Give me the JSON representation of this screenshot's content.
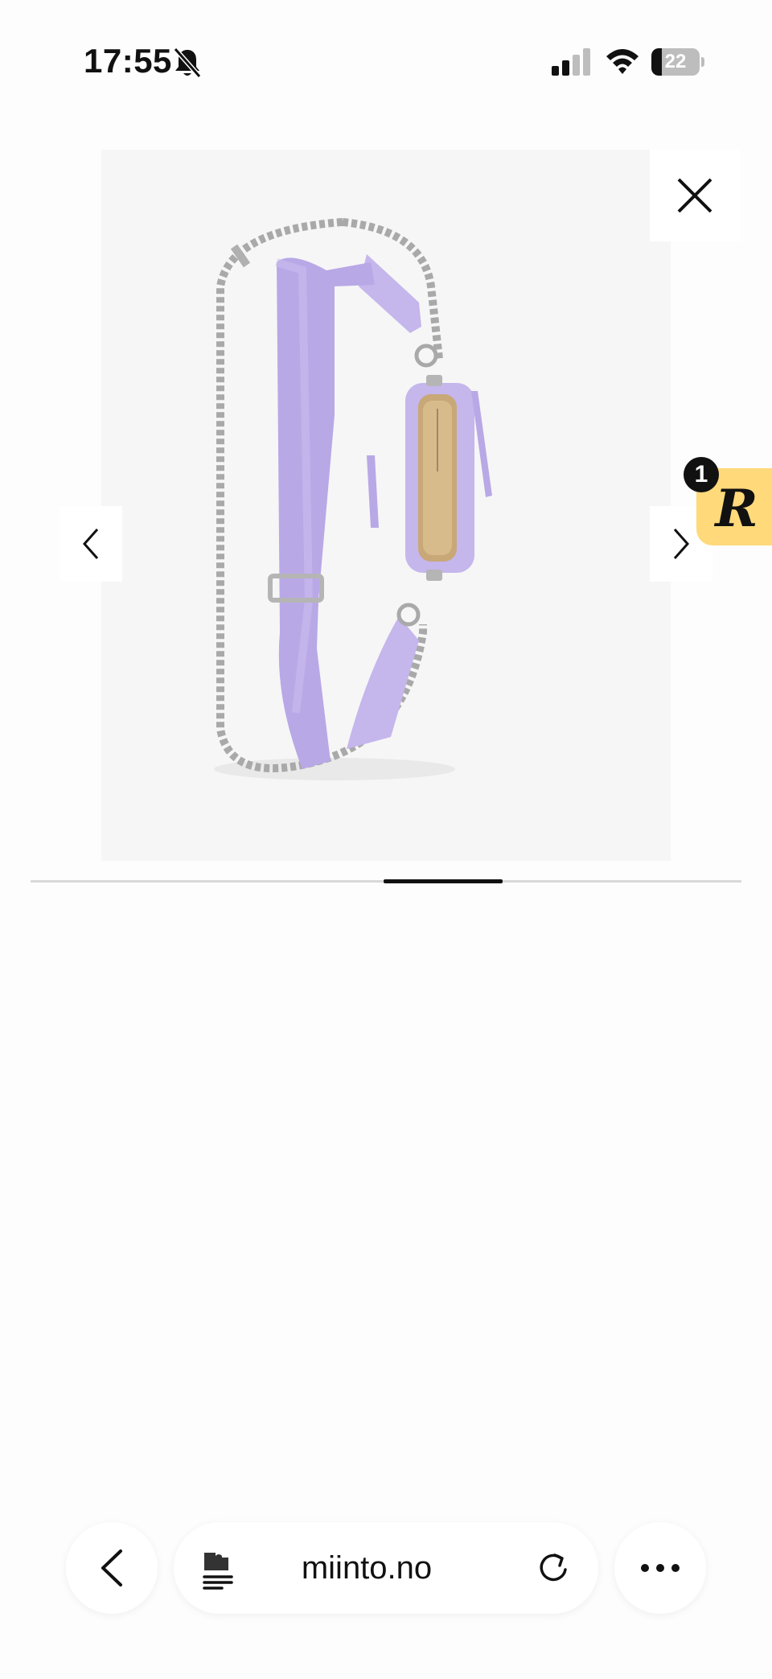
{
  "status_bar": {
    "time": "17:55",
    "battery_level": "22",
    "battery_fraction": 0.22,
    "silent_icon": "bell-slash-icon",
    "signal_icon": "cellular-signal-icon",
    "wifi_icon": "wifi-icon"
  },
  "gallery": {
    "image_description_icon": "product-photo",
    "close_icon": "close-icon",
    "prev_icon": "chevron-left-icon",
    "next_icon": "chevron-right-icon",
    "strap_color": "#b9a8e6",
    "bag_color": "#c5b6ec",
    "current_slide_fraction": 0.5,
    "visible_fraction": 0.167
  },
  "reward_badge": {
    "letter": "R",
    "count": "1",
    "color": "#ffd97a"
  },
  "browser_toolbar": {
    "back_icon": "chevron-left-icon",
    "page_menu_icon": "page-menu-icon",
    "address": "miinto.no",
    "reload_icon": "reload-icon",
    "more_icon": "ellipsis-icon"
  }
}
